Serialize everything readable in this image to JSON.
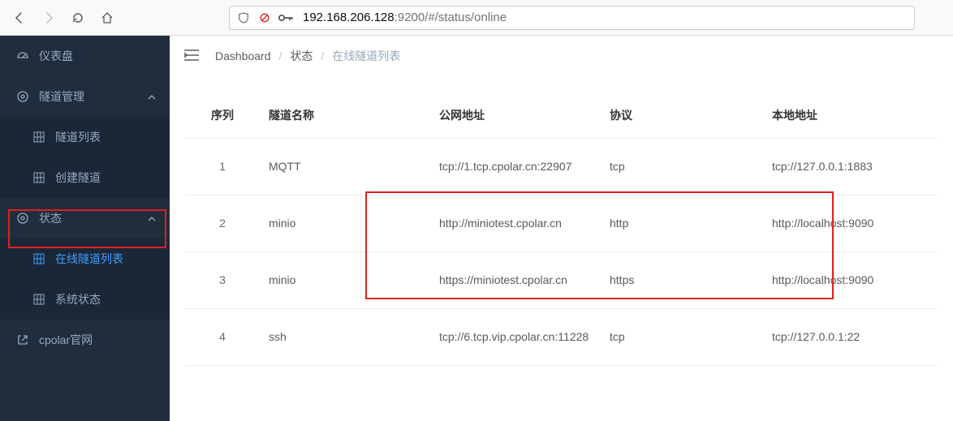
{
  "browser": {
    "url_host": "192.168.206.128",
    "url_rest": ":9200/#/status/online"
  },
  "sidebar": {
    "dashboard": {
      "label": "仪表盘"
    },
    "tunnel": {
      "label": "隧道管理",
      "items": [
        {
          "label": "隧道列表"
        },
        {
          "label": "创建隧道"
        }
      ]
    },
    "status": {
      "label": "状态",
      "items": [
        {
          "label": "在线隧道列表"
        },
        {
          "label": "系统状态"
        }
      ]
    },
    "external": {
      "label": "cpolar官网"
    }
  },
  "breadcrumb": {
    "root": "Dashboard",
    "mid": "状态",
    "last": "在线隧道列表"
  },
  "table": {
    "headers": {
      "seq": "序列",
      "name": "隧道名称",
      "public": "公网地址",
      "proto": "协议",
      "local": "本地地址"
    },
    "rows": [
      {
        "seq": "1",
        "name": "MQTT",
        "public": "tcp://1.tcp.cpolar.cn:22907",
        "proto": "tcp",
        "local": "tcp://127.0.0.1:1883"
      },
      {
        "seq": "2",
        "name": "minio",
        "public": "http://miniotest.cpolar.cn",
        "proto": "http",
        "local": "http://localhost:9090"
      },
      {
        "seq": "3",
        "name": "minio",
        "public": "https://miniotest.cpolar.cn",
        "proto": "https",
        "local": "http://localhost:9090"
      },
      {
        "seq": "4",
        "name": "ssh",
        "public": "tcp://6.tcp.vip.cpolar.cn:11228",
        "proto": "tcp",
        "local": "tcp://127.0.0.1:22"
      }
    ]
  }
}
